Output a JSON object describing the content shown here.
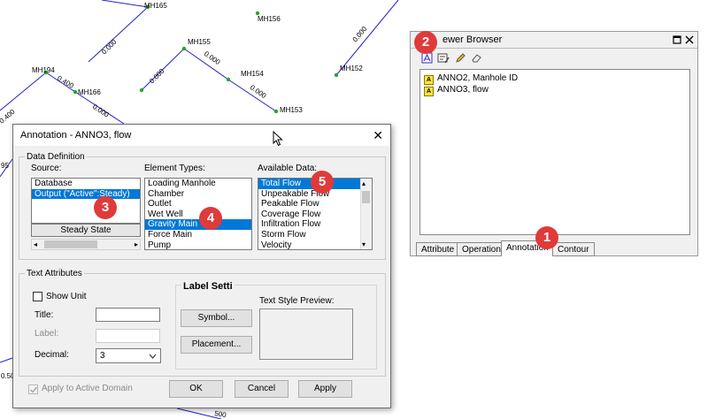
{
  "network": {
    "labels": {
      "mh165": "MH165",
      "mh156": "MH156",
      "mh155": "MH155",
      "mh154": "MH154",
      "mh153": "MH153",
      "mh194": "MH194",
      "mh166": "MH166",
      "mh152": "MH152",
      "flow_a": "0.000",
      "flow_b": "0.000",
      "flow_c": "0.000",
      "flow_d": "0.000",
      "flow_e": "0.000",
      "flow_f": "0.400",
      "flow_g": "0.000",
      "flow_h": "0.400",
      "flow_i": "0.000",
      "partial_95": "95",
      "partial_50": "0.50",
      "partial_500": "500"
    }
  },
  "viewer_browser": {
    "title": "ewer Browser",
    "items": [
      "ANNO2, Manhole ID",
      "ANNO3, flow"
    ],
    "tabs": [
      "Attribute",
      "Operation",
      "Annotation",
      "Contour"
    ],
    "active_tab": "Annotation"
  },
  "dialog": {
    "title": "Annotation - ANNO3, flow",
    "close": "✕",
    "data_definition": {
      "legend": "Data Definition",
      "source_label": "Source:",
      "source_items": [
        "Database",
        "Output (\"Active\":Steady)"
      ],
      "source_selected": 1,
      "steady_state": "Steady State",
      "element_types_label": "Element Types:",
      "element_types": [
        "Loading Manhole",
        "Chamber",
        "Outlet",
        "Wet Well",
        "Gravity Main",
        "Force Main",
        "Pump"
      ],
      "element_selected": 4,
      "available_data_label": "Available Data:",
      "available_data": [
        "Total Flow",
        "Unpeakable Flow",
        "Peakable Flow",
        "Coverage Flow",
        "Infiltration Flow",
        "Storm Flow",
        "Velocity"
      ],
      "available_selected": 0
    },
    "text_attributes": {
      "legend": "Text Attributes",
      "show_unit": "Show Unit",
      "title_label": "Title:",
      "title_value": "",
      "label_label": "Label:",
      "label_value": "",
      "decimal_label": "Decimal:",
      "decimal_value": "3"
    },
    "label_setting": {
      "heading": "Label Setti",
      "symbol_button": "Symbol...",
      "placement_button": "Placement...",
      "preview_label": "Text Style Preview:"
    },
    "apply_domain": "Apply to Active Domain",
    "ok": "OK",
    "cancel": "Cancel",
    "apply": "Apply"
  },
  "callouts": [
    "1",
    "2",
    "3",
    "4",
    "5"
  ],
  "colors": {
    "accent": "#0078d7",
    "badge": "#e03a3a",
    "pipe": "#2020d0",
    "node": "#22aa22"
  }
}
